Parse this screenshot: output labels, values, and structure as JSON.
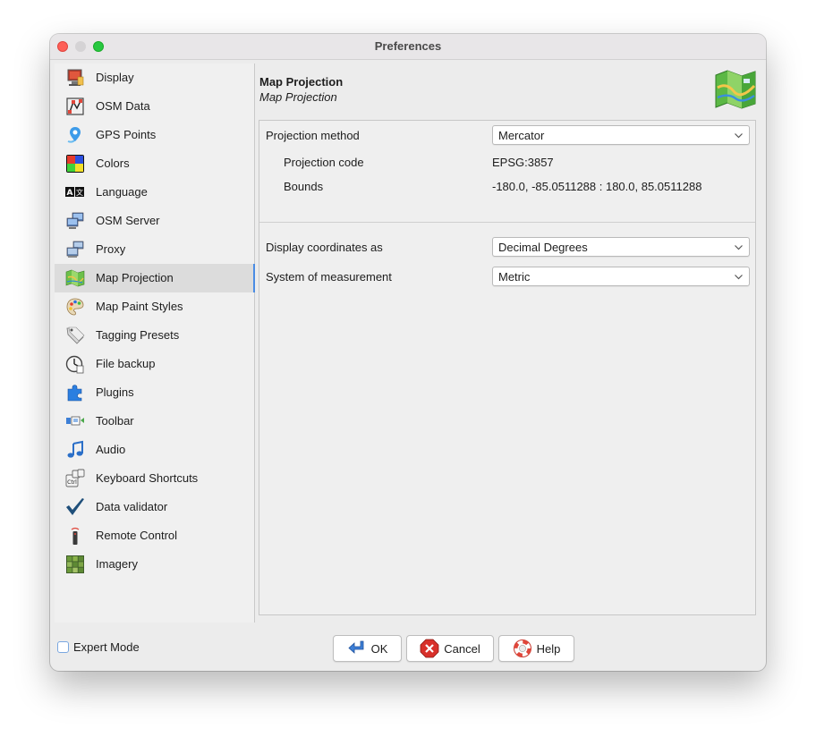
{
  "window": {
    "title": "Preferences"
  },
  "sidebar": {
    "items": [
      {
        "label": "Display",
        "icon": "display-icon"
      },
      {
        "label": "OSM Data",
        "icon": "osm-data-icon"
      },
      {
        "label": "GPS Points",
        "icon": "gps-points-icon"
      },
      {
        "label": "Colors",
        "icon": "colors-icon"
      },
      {
        "label": "Language",
        "icon": "language-icon"
      },
      {
        "label": "OSM Server",
        "icon": "osm-server-icon"
      },
      {
        "label": "Proxy",
        "icon": "proxy-icon"
      },
      {
        "label": "Map Projection",
        "icon": "map-projection-icon",
        "selected": true
      },
      {
        "label": "Map Paint Styles",
        "icon": "map-paint-styles-icon"
      },
      {
        "label": "Tagging Presets",
        "icon": "tagging-presets-icon"
      },
      {
        "label": "File backup",
        "icon": "file-backup-icon"
      },
      {
        "label": "Plugins",
        "icon": "plugins-icon"
      },
      {
        "label": "Toolbar",
        "icon": "toolbar-icon"
      },
      {
        "label": "Audio",
        "icon": "audio-icon"
      },
      {
        "label": "Keyboard Shortcuts",
        "icon": "keyboard-shortcuts-icon"
      },
      {
        "label": "Data validator",
        "icon": "data-validator-icon"
      },
      {
        "label": "Remote Control",
        "icon": "remote-control-icon"
      },
      {
        "label": "Imagery",
        "icon": "imagery-icon"
      }
    ]
  },
  "header": {
    "title": "Map Projection",
    "subtitle": "Map Projection"
  },
  "projection": {
    "method_label": "Projection method",
    "method_value": "Mercator",
    "code_label": "Projection code",
    "code_value": "EPSG:3857",
    "bounds_label": "Bounds",
    "bounds_value": "-180.0, -85.0511288 : 180.0, 85.0511288"
  },
  "display": {
    "coords_label": "Display coordinates as",
    "coords_value": "Decimal Degrees",
    "measure_label": "System of measurement",
    "measure_value": "Metric"
  },
  "footer": {
    "expert_mode_label": "Expert Mode",
    "expert_mode_checked": false,
    "ok_label": "OK",
    "cancel_label": "Cancel",
    "help_label": "Help"
  },
  "colors": {
    "selection_accent": "#4a8ce4",
    "window_bg": "#ececec"
  }
}
